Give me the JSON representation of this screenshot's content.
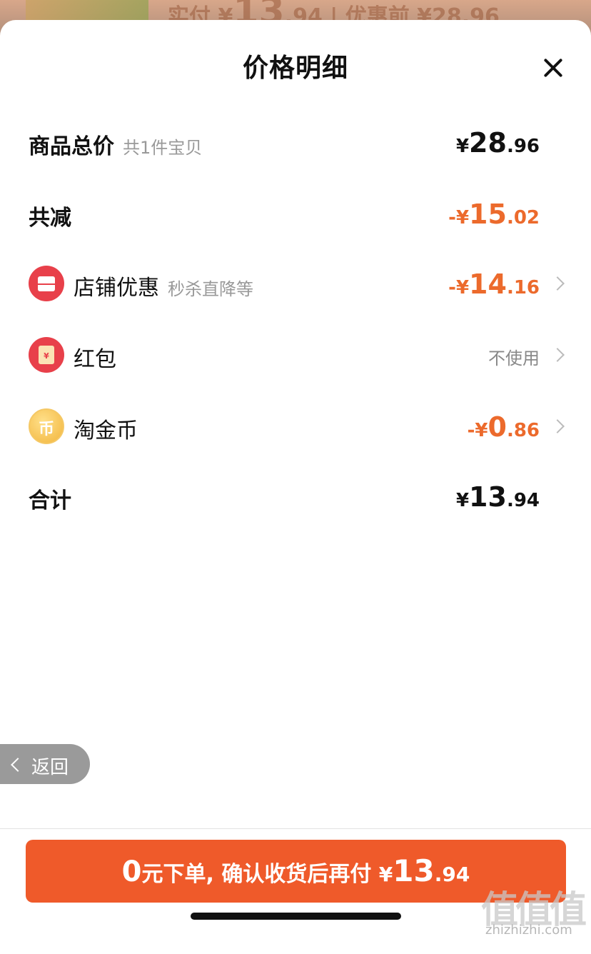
{
  "backdrop": {
    "summary_prefix": "实付 ¥",
    "summary_int": "13",
    "summary_dec": ".94",
    "summary_sep": " | ",
    "summary_original": "优惠前 ¥28.96"
  },
  "sheet": {
    "title": "价格明细",
    "close_icon": "close-icon"
  },
  "rows": {
    "goods_total": {
      "label": "商品总价",
      "sub": "共1件宝贝",
      "currency": "¥",
      "int": "28",
      "dec": ".96"
    },
    "total_discount": {
      "label": "共减",
      "currency": "-¥",
      "int": "15",
      "dec": ".02",
      "color": "#ec6a2c"
    },
    "store_discount": {
      "icon": "store-icon",
      "label": "店铺优惠",
      "sub": "秒杀直降等",
      "currency": "-¥",
      "int": "14",
      "dec": ".16"
    },
    "red_packet": {
      "icon": "red-envelope-icon",
      "label": "红包",
      "value": "不使用",
      "glyph": "¥"
    },
    "taojinbi": {
      "icon": "coin-icon",
      "label": "淘金币",
      "glyph": "币",
      "currency": "-¥",
      "int": "0",
      "dec": ".86"
    },
    "sum": {
      "label": "合计",
      "currency": "¥",
      "int": "13",
      "dec": ".94"
    }
  },
  "back_button": {
    "label": "返回"
  },
  "cta": {
    "zero": "0",
    "text": "元下单, 确认收货后再付 ",
    "currency": "¥",
    "int": "13",
    "dec": ".94",
    "color": "#ef5a2a"
  },
  "watermark": {
    "line1": "值值值",
    "line2": "zhizhizhi.com"
  }
}
